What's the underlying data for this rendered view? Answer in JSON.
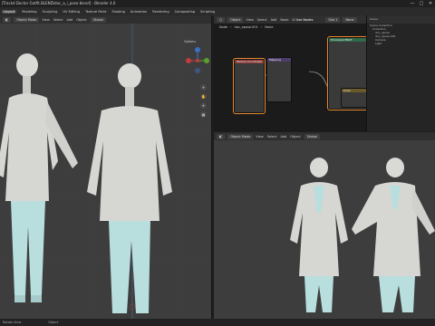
{
  "window": {
    "title": "[Trackd Doctor Outfit.BLEND\\doc_a_i_pose.blend] - Blender 4.0",
    "minimize": "—",
    "maximize": "□",
    "close": "✕"
  },
  "menu": {
    "items": [
      "Layout",
      "Modeling",
      "Sculpting",
      "UV Editing",
      "Texture Paint",
      "Shading",
      "Animation",
      "Rendering",
      "Compositing",
      "Scripting"
    ],
    "active_index": 0
  },
  "left_viewport": {
    "header": {
      "mode": "Object Mode",
      "view": "View",
      "select": "Select",
      "add": "Add",
      "object": "Object",
      "global": "Global"
    },
    "options": "Options"
  },
  "node_editor": {
    "header": {
      "type": "Object",
      "view": "View",
      "select": "Select",
      "add": "Add",
      "node": "Node",
      "use_nodes": "Use Nodes",
      "slot": "Slot 1",
      "material": "None"
    },
    "breadcrumb": {
      "object": "Node",
      "mesh": "doc_apose.001",
      "material": "None"
    },
    "nodes": {
      "mapping": "Mapping",
      "tex_coord": "Texture Coordinate",
      "bsdf": "Principled BSDF",
      "output": "Material Output",
      "color": "Color"
    }
  },
  "outliner": {
    "header": "Scene",
    "rows": [
      "Scene Collection",
      "Collection",
      "doc_apose",
      "doc_apose.001",
      "Camera",
      "Light"
    ]
  },
  "right_viewport": {
    "header": {
      "mode": "Object Mode",
      "view": "View",
      "select": "Select",
      "add": "Add",
      "object": "Object",
      "global": "Global"
    }
  },
  "statusbar": {
    "left": "Rotate View",
    "middle": "Object",
    "right": ""
  },
  "colors": {
    "accent": "#e88a2e",
    "x_axis": "#c13b3b",
    "y_axis": "#5a9e2f",
    "z_axis": "#3b6fc1",
    "shirt": "#d6d6d2",
    "pants": "#b9dede"
  }
}
